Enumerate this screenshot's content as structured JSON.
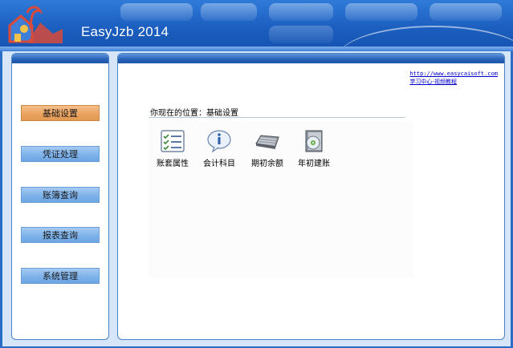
{
  "app": {
    "title": "EasyJzb 2014"
  },
  "sidebar": {
    "items": [
      {
        "label": "基础设置",
        "active": true
      },
      {
        "label": "凭证处理",
        "active": false
      },
      {
        "label": "账簿查询",
        "active": false
      },
      {
        "label": "报表查询",
        "active": false
      },
      {
        "label": "系统管理",
        "active": false
      }
    ]
  },
  "main": {
    "links": {
      "website": "http://www.easycaisoft.com",
      "tutorial": "学习中心-视频教程"
    },
    "location_text": "你现在的位置：基础设置",
    "icons": [
      {
        "label": "账套属性",
        "icon": "checklist-icon"
      },
      {
        "label": "会计科目",
        "icon": "info-icon"
      },
      {
        "label": "期初余额",
        "icon": "keyboard-icon"
      },
      {
        "label": "年初建账",
        "icon": "book-cd-icon"
      }
    ]
  },
  "colors": {
    "header_blue": "#1c5fc0",
    "active_button": "#eaa15e",
    "button_blue": "#7eb2ea",
    "link": "#0000cc"
  }
}
